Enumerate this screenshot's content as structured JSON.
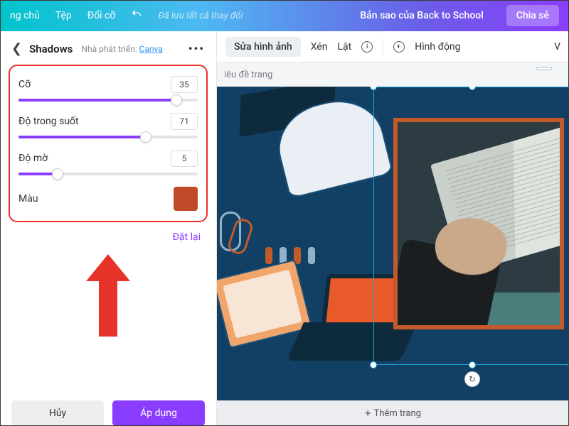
{
  "topbar": {
    "home": "ng chủ",
    "file": "Tệp",
    "resize": "Đổi cỡ",
    "saved": "Đã lưu tất cả thay đổi",
    "doc_title": "Bản sao của Back to School",
    "share": "Chia sẻ"
  },
  "panel": {
    "title": "Shadows",
    "dev_prefix": "Nhà phát triển:",
    "dev_link": "Canva",
    "sliders": {
      "size": {
        "label": "Cỡ",
        "value": "35",
        "pct": 88
      },
      "opacity": {
        "label": "Độ trong suốt",
        "value": "71",
        "pct": 71
      },
      "blur": {
        "label": "Độ mờ",
        "value": "5",
        "pct": 22
      }
    },
    "color_label": "Màu",
    "color_value": "#c0492a",
    "reset": "Đặt lại",
    "cancel": "Hủy",
    "apply": "Áp dụng"
  },
  "toolbar": {
    "edit_image": "Sửa hình ảnh",
    "crop": "Xén",
    "flip": "Lật",
    "animate": "Hình động",
    "right_cut": "V"
  },
  "canvas": {
    "page_title": "iêu đề trang",
    "add_page": "Thêm trang",
    "rot_icon": "↻"
  }
}
